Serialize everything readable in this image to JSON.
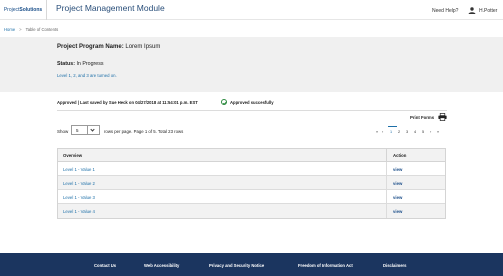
{
  "header": {
    "logo_prefix": "Project",
    "logo_suffix": "Solutions",
    "title": "Project Management Module",
    "help_link": "Need Help?",
    "user_name": "H.Potter"
  },
  "breadcrumb": {
    "home": "Home",
    "separator": ">",
    "current": "Table of Contents"
  },
  "program": {
    "name_label": "Project Program Name:",
    "name_value": "Lorem Ipsum",
    "status_label": "Status:",
    "status_value": "In Progress",
    "levels_note": "Level 1, 2, and 3 are turned on."
  },
  "approval": {
    "saved_text": "Approved | Last saved by Sue Heck on 04/27/2018 at 11:54:01 p.m. EST",
    "success_text": "Approved succesfully"
  },
  "print_forms_label": "Print Forms",
  "table_controls": {
    "show_label": "Show",
    "show_value": "5",
    "rows_info": "rows per page. Page 1 of 5. Total 23 rows"
  },
  "pagination": {
    "first": "«",
    "prev": "‹",
    "pages": [
      "1",
      "2",
      "3",
      "4",
      "5"
    ],
    "next": "›",
    "last": "»",
    "current_page": "1"
  },
  "table": {
    "headers": {
      "overview": "Overview",
      "action": "Action"
    },
    "rows": [
      {
        "overview": "Level 1 - Value 1",
        "action": "view"
      },
      {
        "overview": "Level 1 - Value 2",
        "action": "view"
      },
      {
        "overview": "Level 1 - Value 3",
        "action": "view"
      },
      {
        "overview": "Level 1 - Value 4",
        "action": "view"
      }
    ]
  },
  "footer": {
    "links": [
      "Contact Us",
      "Web Accessibility",
      "Privacy and Security Notice",
      "Freedom of Information Act",
      "Disclaimers"
    ]
  },
  "colors": {
    "brand_navy": "#1b355f",
    "link_blue": "#1d6fa8",
    "success_green": "#2c8a3f",
    "panel_gray": "#f0f0f0"
  },
  "icons": {
    "user": "user-icon",
    "check": "check-circle-icon",
    "print": "printer-icon",
    "dropdown": "chevron-down-icon"
  }
}
